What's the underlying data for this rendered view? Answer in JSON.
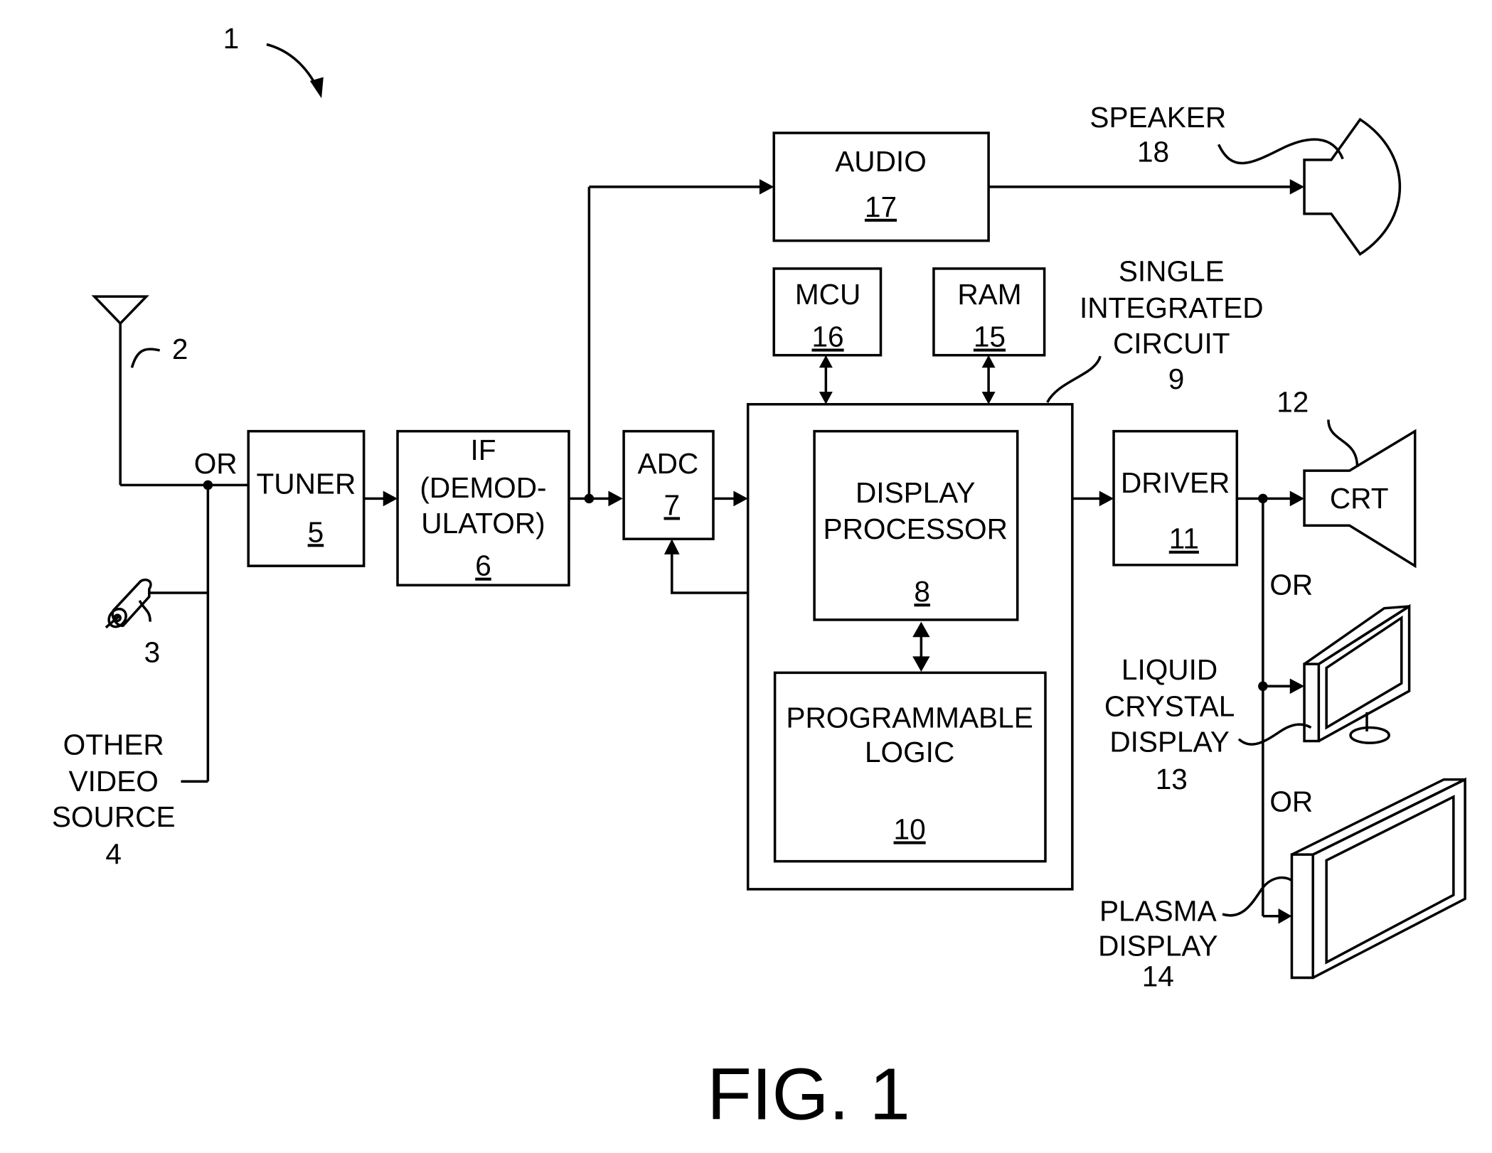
{
  "figure": {
    "caption": "FIG. 1",
    "system_ref": "1"
  },
  "sources": {
    "antenna_ref": "2",
    "cable_ref": "3",
    "other_video_source": [
      "OTHER",
      "VIDEO",
      "SOURCE"
    ],
    "other_video_source_ref": "4",
    "or_label": "OR"
  },
  "blocks": {
    "tuner": {
      "label": "TUNER",
      "ref": "5"
    },
    "if_demod": {
      "lines": [
        "IF",
        "(DEMOD-",
        "ULATOR)"
      ],
      "ref": "6"
    },
    "adc": {
      "label": "ADC",
      "ref": "7"
    },
    "display_processor": {
      "lines": [
        "DISPLAY",
        "PROCESSOR"
      ],
      "ref": "8"
    },
    "single_ic": {
      "lines": [
        "SINGLE",
        "INTEGRATED",
        "CIRCUIT"
      ],
      "ref": "9"
    },
    "programmable_logic": {
      "lines": [
        "PROGRAMMABLE",
        "LOGIC"
      ],
      "ref": "10"
    },
    "driver": {
      "label": "DRIVER",
      "ref": "11"
    },
    "mcu": {
      "label": "MCU",
      "ref": "16"
    },
    "ram": {
      "label": "RAM",
      "ref": "15"
    },
    "audio": {
      "label": "AUDIO",
      "ref": "17"
    }
  },
  "outputs": {
    "speaker": {
      "label": "SPEAKER",
      "ref": "18"
    },
    "crt": {
      "label": "CRT",
      "ref": "12"
    },
    "lcd": {
      "lines": [
        "LIQUID",
        "CRYSTAL",
        "DISPLAY"
      ],
      "ref": "13"
    },
    "plasma": {
      "lines": [
        "PLASMA",
        "DISPLAY"
      ],
      "ref": "14"
    },
    "or_label_1": "OR",
    "or_label_2": "OR"
  }
}
